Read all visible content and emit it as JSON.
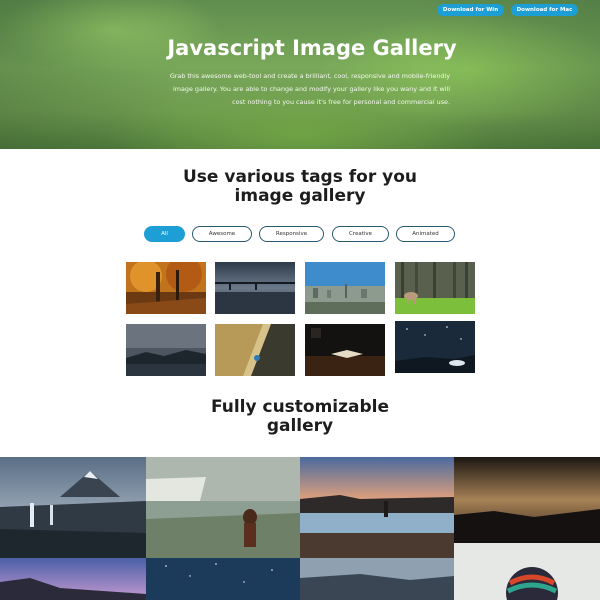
{
  "hero": {
    "title": "Javascript Image Gallery",
    "description": "Grab this awesome web-tool and create a brilliant, cool, responsive and mobile-friendly image gallery. You are able to change and modify your gallery like you wany and it will cost nothing to you cause it's free for personal and commercial use.",
    "buttons": [
      "Download for Win",
      "Download for Mac"
    ]
  },
  "tags_section": {
    "title_line1": "Use various tags for you",
    "title_line2": "image gallery",
    "tags": [
      "All",
      "Awesome",
      "Responsive",
      "Creative",
      "Animated"
    ],
    "active_tag": "All"
  },
  "custom_section": {
    "title_line1": "Fully customizable",
    "title_line2": "gallery"
  },
  "colors": {
    "accent": "#1d9fd6",
    "tag_border": "#2a5a6e"
  }
}
